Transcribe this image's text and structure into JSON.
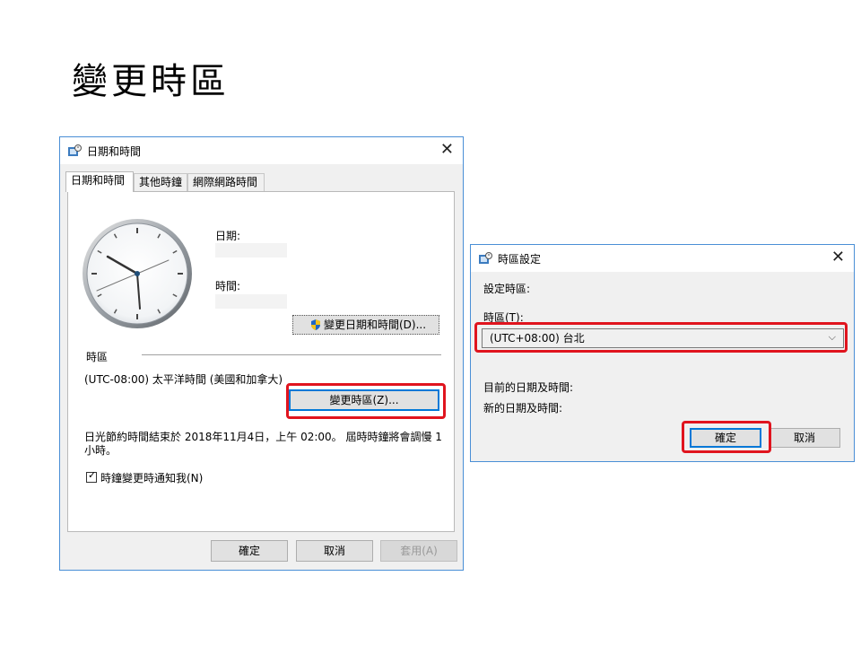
{
  "slide": {
    "title": "變更時區"
  },
  "dialog_datetime": {
    "title": "日期和時間",
    "close": "✕",
    "tabs": [
      "日期和時間",
      "其他時鐘",
      "網際網路時間"
    ],
    "date_label": "日期:",
    "time_label": "時間:",
    "change_datetime_button": "變更日期和時間(D)...",
    "timezone_section": "時區",
    "timezone_value": "(UTC-08:00) 太平洋時間 (美國和加拿大)",
    "change_timezone_button": "變更時區(Z)...",
    "dst_notice_line1": "日光節約時間結束於 2018年11月4日，上午 02:00。 屆時時鐘將會調慢 1",
    "dst_notice_line2": "小時。",
    "notify_checkbox": "時鐘變更時通知我(N)",
    "notify_checked": true,
    "ok_button": "確定",
    "cancel_button": "取消",
    "apply_button": "套用(A)"
  },
  "dialog_timezone": {
    "title": "時區設定",
    "close": "✕",
    "set_timezone_label": "設定時區:",
    "timezone_field_label": "時區(T):",
    "timezone_selected": "(UTC+08:00) 台北",
    "current_datetime_label": "目前的日期及時間:",
    "new_datetime_label": "新的日期及時間:",
    "ok_button": "確定",
    "cancel_button": "取消"
  },
  "colors": {
    "highlight": "#e0141e",
    "window_border": "#4a8fd6",
    "focus": "#0078d7"
  }
}
